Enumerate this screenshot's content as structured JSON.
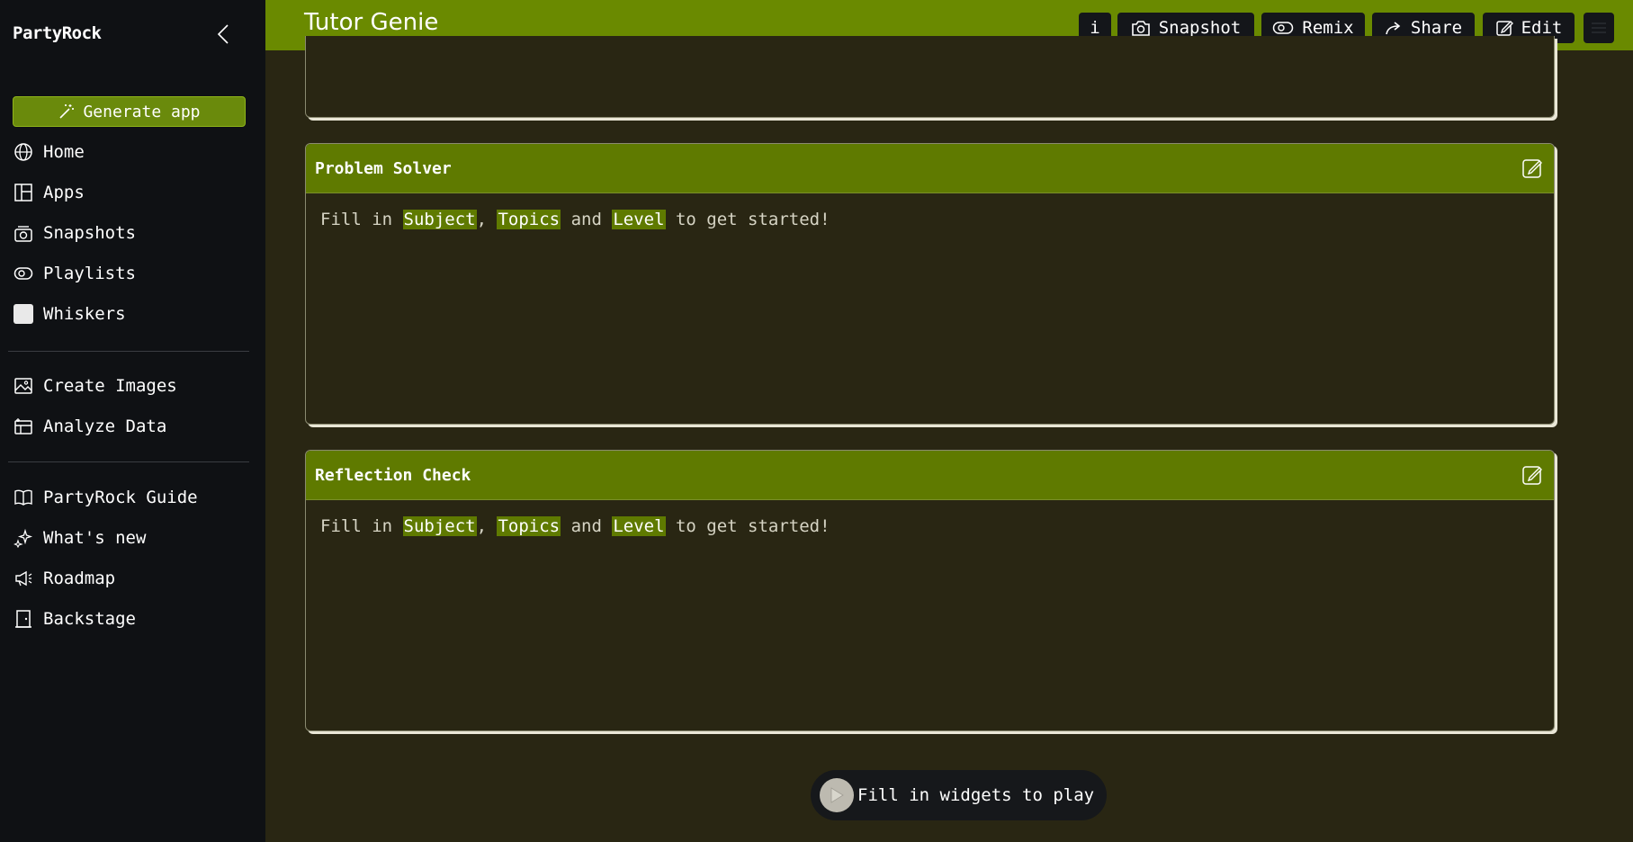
{
  "sidebar": {
    "brand": "PartyRock",
    "generate_label": "Generate app",
    "primary_items": [
      {
        "label": "Home",
        "icon": "globe-icon"
      },
      {
        "label": "Apps",
        "icon": "layout-icon"
      },
      {
        "label": "Snapshots",
        "icon": "camera-stack-icon"
      },
      {
        "label": "Playlists",
        "icon": "playlist-icon"
      },
      {
        "label": "Whiskers",
        "icon": "whiskers-avatar"
      }
    ],
    "tool_items": [
      {
        "label": "Create Images",
        "icon": "image-icon"
      },
      {
        "label": "Analyze Data",
        "icon": "data-icon"
      }
    ],
    "help_items": [
      {
        "label": "PartyRock Guide",
        "icon": "book-icon"
      },
      {
        "label": "What's new",
        "icon": "sparkle-icon"
      },
      {
        "label": "Roadmap",
        "icon": "megaphone-icon"
      },
      {
        "label": "Backstage",
        "icon": "door-icon"
      }
    ]
  },
  "header": {
    "title": "Tutor Genie",
    "info_label": "i",
    "snapshot_label": "Snapshot",
    "remix_label": "Remix",
    "share_label": "Share",
    "edit_label": "Edit"
  },
  "cards": [
    {
      "title": "Problem Solver",
      "prefix": "Fill in ",
      "field1": "Subject",
      "sep1": ", ",
      "field2": "Topics",
      "sep2": " and ",
      "field3": "Level",
      "suffix": " to get started!"
    },
    {
      "title": "Reflection Check",
      "prefix": "Fill in ",
      "field1": "Subject",
      "sep1": ", ",
      "field2": "Topics",
      "sep2": " and ",
      "field3": "Level",
      "suffix": " to get started!"
    }
  ],
  "play": {
    "label": "Fill in widgets to play"
  },
  "colors": {
    "accent": "#6a8a00",
    "background": "#292613",
    "sidebar": "#0f1114"
  }
}
